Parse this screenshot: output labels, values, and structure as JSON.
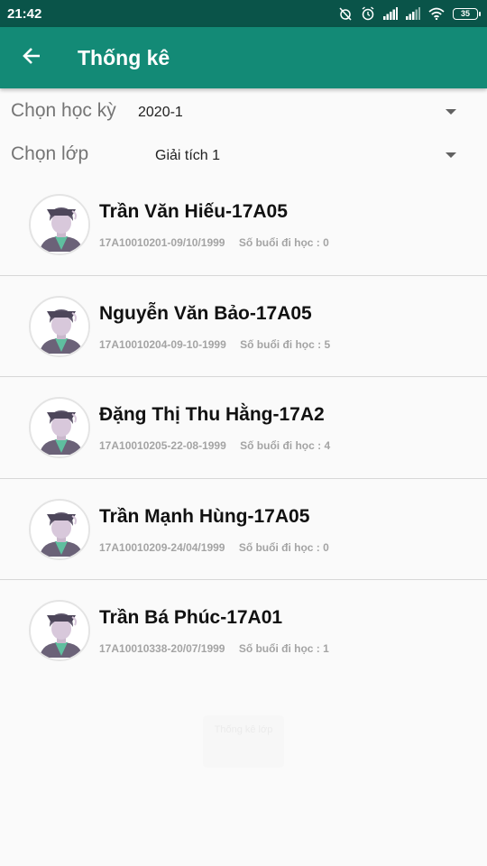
{
  "status_bar": {
    "time": "21:42",
    "battery": "35",
    "icons": [
      "alarm-off-icon",
      "alarm-icon",
      "signal-icon",
      "signal-icon",
      "wifi-icon",
      "battery-icon"
    ]
  },
  "app_bar": {
    "title": "Thống kê",
    "back_icon": "arrow-left-icon",
    "background": "#138a76",
    "status_background": "#0a5449"
  },
  "filters": {
    "semester": {
      "label": "Chọn học kỳ",
      "value": "2020-1"
    },
    "class": {
      "label": "Chọn lớp",
      "value": "Giải tích 1"
    }
  },
  "students": [
    {
      "name": "Trần Văn Hiếu-17A05",
      "id_dob": "17A10010201-09/10/1999",
      "attendance": "Số buổi đi học : 0"
    },
    {
      "name": "Nguyễn Văn Bảo-17A05",
      "id_dob": "17A10010204-09-10-1999",
      "attendance": "Số buổi đi học : 5"
    },
    {
      "name": "Đặng Thị Thu Hằng-17A2",
      "id_dob": "17A10010205-22-08-1999",
      "attendance": "Số buổi đi học : 4"
    },
    {
      "name": "Trần Mạnh Hùng-17A05",
      "id_dob": "17A10010209-24/04/1999",
      "attendance": "Số buổi đi học : 0"
    },
    {
      "name": "Trần Bá Phúc-17A01",
      "id_dob": "17A10010338-20/07/1999",
      "attendance": "Số buổi đi học : 1"
    }
  ],
  "ghost_button": {
    "label": "Thống kê lớp"
  }
}
